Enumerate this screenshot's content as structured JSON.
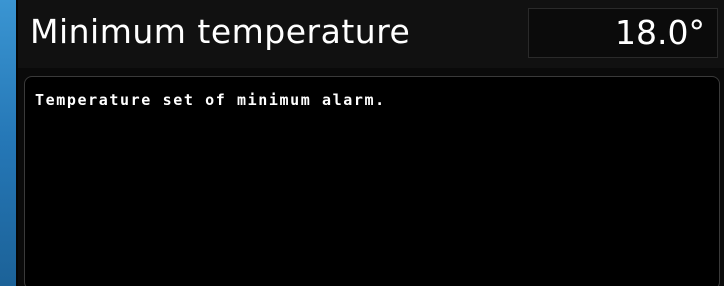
{
  "header": {
    "title": "Minimum temperature",
    "value": "18.0°"
  },
  "description": {
    "text": "Temperature set of minimum alarm."
  }
}
